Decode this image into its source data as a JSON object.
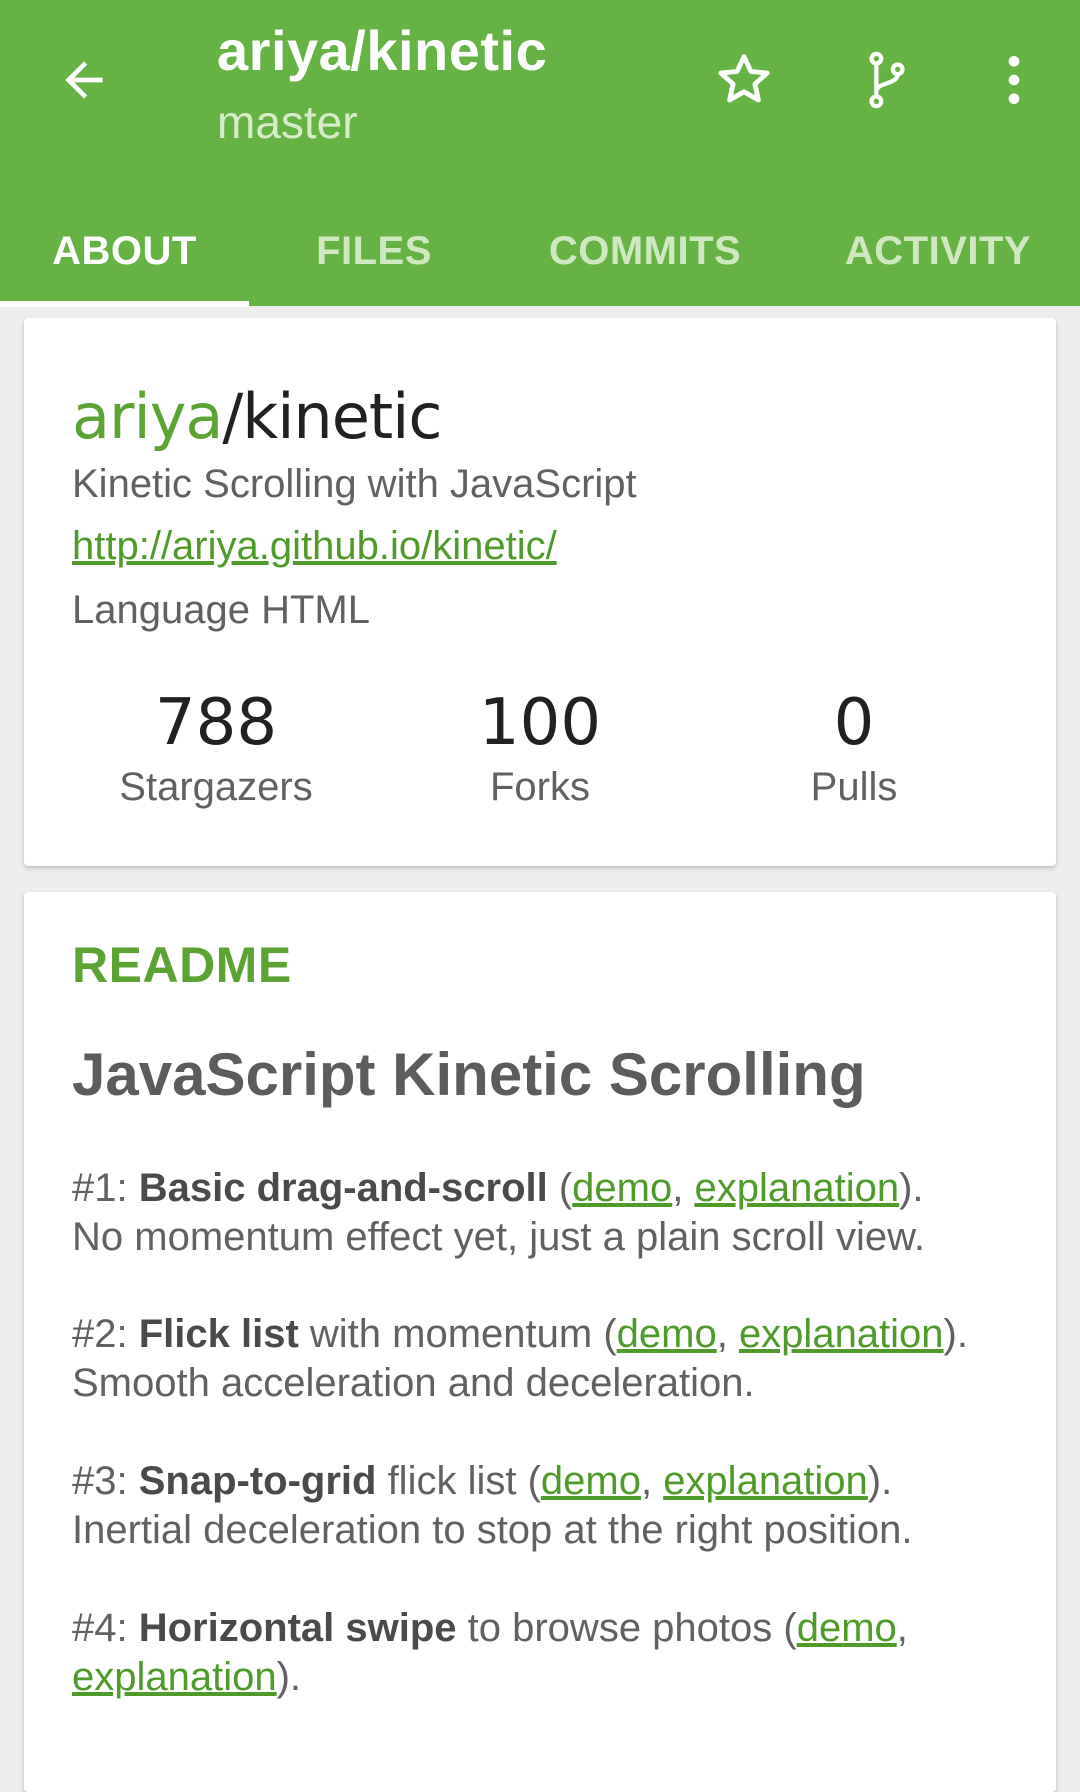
{
  "colors": {
    "primary": "#66b245",
    "accent_text": "#5da234",
    "link": "#4f9a2a"
  },
  "appbar": {
    "title": "ariya/kinetic",
    "subtitle": "master",
    "icons": [
      "back-arrow-icon",
      "star-icon",
      "branch-icon",
      "more-vert-icon"
    ]
  },
  "tabs": [
    {
      "label": "ABOUT",
      "active": true
    },
    {
      "label": "FILES",
      "active": false
    },
    {
      "label": "COMMITS",
      "active": false
    },
    {
      "label": "ACTIVITY",
      "active": false
    }
  ],
  "repo": {
    "owner": "ariya",
    "separator": "/",
    "name": "kinetic",
    "description": "Kinetic Scrolling with JavaScript",
    "url": "http://ariya.github.io/kinetic/",
    "language": "Language HTML",
    "stats": [
      {
        "value": "788",
        "label": "Stargazers"
      },
      {
        "value": "100",
        "label": "Forks"
      },
      {
        "value": "0",
        "label": "Pulls"
      }
    ]
  },
  "readme": {
    "title": "README",
    "heading": "JavaScript Kinetic Scrolling",
    "items": [
      {
        "num": "#1: ",
        "bold": "Basic drag-and-scroll",
        "mid": " (",
        "demo": "demo",
        "comma": ", ",
        "explanation": "explanation",
        "end": ").",
        "tail": "No momentum effect yet, just a plain scroll view."
      },
      {
        "num": "#2: ",
        "bold": "Flick list",
        "mid": " with momentum (",
        "demo": "demo",
        "comma": ", ",
        "explanation": "explanation",
        "end": ").",
        "tail": "Smooth acceleration and deceleration."
      },
      {
        "num": "#3: ",
        "bold": "Snap-to-grid",
        "mid": " flick list (",
        "demo": "demo",
        "comma": ", ",
        "explanation": "explanation",
        "end": ").",
        "tail": "Inertial deceleration to stop at the right position."
      },
      {
        "num": "#4: ",
        "bold": "Horizontal swipe",
        "mid": " to browse photos (",
        "demo": "demo",
        "comma": ",",
        "explanation": "explanation",
        "end": ").",
        "tail": ""
      }
    ]
  }
}
